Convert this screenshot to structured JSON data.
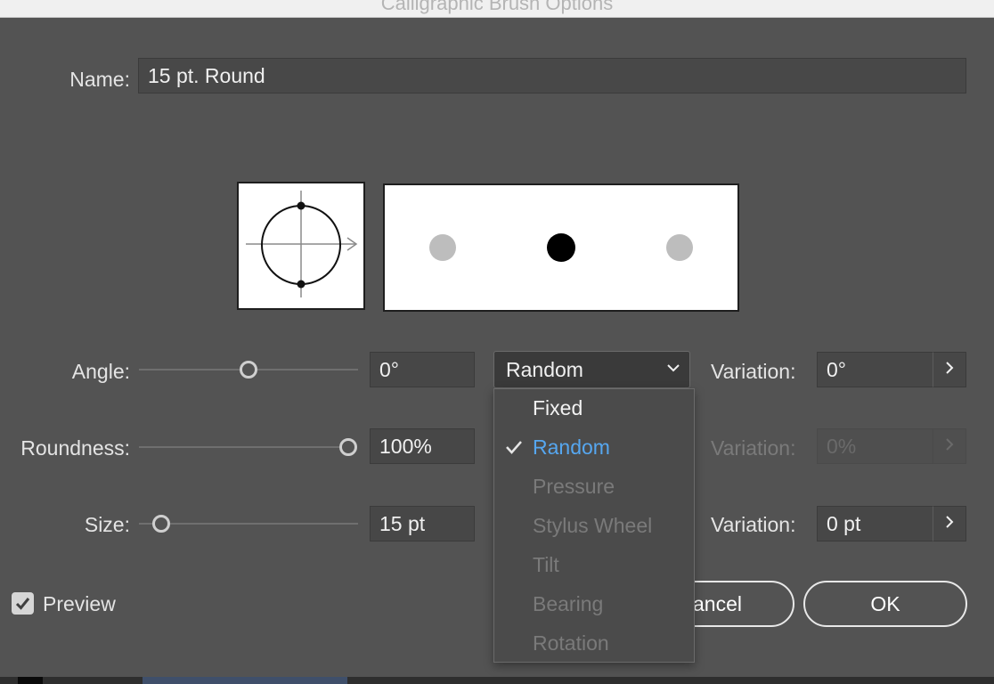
{
  "window": {
    "title": "Calligraphic Brush Options"
  },
  "name": {
    "label": "Name:",
    "value": "15 pt. Round"
  },
  "angle": {
    "label": "Angle:",
    "value": "0°",
    "variation_label": "Variation:",
    "variation_value": "0°"
  },
  "roundness": {
    "label": "Roundness:",
    "value": "100%",
    "variation_label": "Variation:",
    "variation_value": "0%"
  },
  "size": {
    "label": "Size:",
    "value": "15 pt",
    "variation_label": "Variation:",
    "variation_value": "0 pt"
  },
  "angle_mode": {
    "selected": "Random",
    "options": [
      "Fixed",
      "Random",
      "Pressure",
      "Stylus Wheel",
      "Tilt",
      "Bearing",
      "Rotation"
    ]
  },
  "preview": {
    "label": "Preview",
    "checked": true
  },
  "buttons": {
    "cancel": "ancel",
    "ok": "OK"
  },
  "icons": {
    "stepper": "chevron-right-icon",
    "dropdown": "chevron-down-icon",
    "check": "checkmark-icon"
  },
  "colors": {
    "selected_item": "#56a7f0",
    "disabled_text": "#7a7a7a",
    "dialog_bg": "#535353"
  }
}
